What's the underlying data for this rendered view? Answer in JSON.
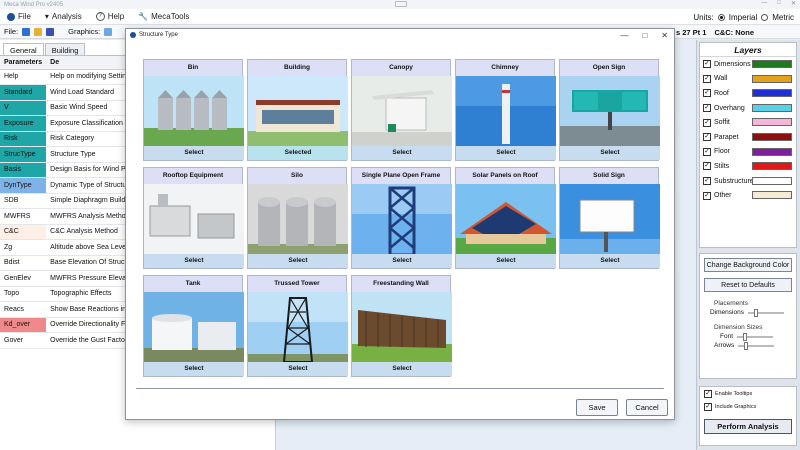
{
  "window": {
    "title": "Meca Wind Pro v2405",
    "controls": [
      "—",
      "□",
      "✕"
    ]
  },
  "menu": {
    "items": [
      {
        "label": "File"
      },
      {
        "label": "Analysis"
      },
      {
        "label": "Help"
      },
      {
        "label": "MecaTools"
      }
    ],
    "units_label": "Units:",
    "unit_imperial": "Imperial",
    "unit_metric": "Metric"
  },
  "toolbar": {
    "file_label": "File:",
    "graphics_label": "Graphics:",
    "zone_info": "s 27 Pt 1",
    "cc_info": "C&C: None"
  },
  "leftpanel": {
    "tabs": [
      "General",
      "Building"
    ],
    "header_code": "Parameters",
    "header_desc": "De",
    "rows": [
      {
        "code": "Help",
        "desc": "Help on modifying Settin",
        "bg": "#ffffff"
      },
      {
        "code": "Standard",
        "desc": "Wind Load Standard",
        "bg": "#1fa6a6"
      },
      {
        "code": "V",
        "desc": "Basic Wind Speed",
        "bg": "#1fa6a6"
      },
      {
        "code": "Exposure",
        "desc": "Exposure Classification",
        "bg": "#1fa6a6"
      },
      {
        "code": "Risk",
        "desc": "Risk Category",
        "bg": "#1fa6a6"
      },
      {
        "code": "StrucType",
        "desc": "Structure Type",
        "bg": "#1fa6a6"
      },
      {
        "code": "Basis",
        "desc": "Design Basis for Wind Pre",
        "bg": "#1fa6a6"
      },
      {
        "code": "DynType",
        "desc": "Dynamic Type of Structur",
        "bg": "#7fb3e8"
      },
      {
        "code": "SDB",
        "desc": "Simple Diaphragm Buildi",
        "bg": "#ffffff"
      },
      {
        "code": "MWFRS",
        "desc": "MWFRS Analysis Method",
        "bg": "#ffffff"
      },
      {
        "code": "C&C",
        "desc": "C&C Analysis Method",
        "bg": "#fdeee6"
      },
      {
        "code": "Zg",
        "desc": "Altitude above Sea Level",
        "bg": "#ffffff"
      },
      {
        "code": "Bdist",
        "desc": "Base Elevation Of Structu",
        "bg": "#ffffff"
      },
      {
        "code": "GenElev",
        "desc": "MWFRS Pressure Elevatio",
        "bg": "#ffffff"
      },
      {
        "code": "Topo",
        "desc": "Topographic Effects",
        "bg": "#ffffff"
      },
      {
        "code": "Reacs",
        "desc": "Show Base Reactions in C",
        "bg": "#ffffff"
      },
      {
        "code": "Kd_over",
        "desc": "Override Directionality Fa",
        "bg": "#f08a8a"
      },
      {
        "code": "Gover",
        "desc": "Override the Gust Factor",
        "bg": "#ffffff"
      }
    ]
  },
  "layers": {
    "title": "Layers",
    "items": [
      {
        "label": "Dimensions",
        "color": "#1e7a1e"
      },
      {
        "label": "Wall",
        "color": "#e2a21c"
      },
      {
        "label": "Roof",
        "color": "#1f2fd6"
      },
      {
        "label": "Overhang",
        "color": "#5ad0e6"
      },
      {
        "label": "Soffit",
        "color": "#f4b7d9"
      },
      {
        "label": "Parapet",
        "color": "#8c1010"
      },
      {
        "label": "Floor",
        "color": "#7e1f9b"
      },
      {
        "label": "Stilts",
        "color": "#e01818"
      },
      {
        "label": "Substructure",
        "color": "#ffffff"
      },
      {
        "label": "Other",
        "color": "#f6ecd6"
      }
    ]
  },
  "options": {
    "change_bg": "Change Background Color",
    "reset": "Reset to Defaults",
    "placements": "Placements",
    "dimensions": "Dimensions",
    "dimension_sizes": "Dimension Sizes",
    "font": "Font",
    "arrows": "Arrows",
    "enable_tooltips": "Enable Tooltips",
    "include_graphics": "Include Graphics",
    "perform": "Perform Analysis"
  },
  "modal": {
    "title": "Structure Type",
    "cards": [
      {
        "title": "Bin",
        "select": "Select",
        "selected": false
      },
      {
        "title": "Building",
        "select": "Selected",
        "selected": true
      },
      {
        "title": "Canopy",
        "select": "Select",
        "selected": false
      },
      {
        "title": "Chimney",
        "select": "Select",
        "selected": false
      },
      {
        "title": "Open Sign",
        "select": "Select",
        "selected": false
      },
      {
        "title": "Rooftop Equipment",
        "select": "Select",
        "selected": false
      },
      {
        "title": "Silo",
        "select": "Select",
        "selected": false
      },
      {
        "title": "Single Plane Open Frame",
        "select": "Select",
        "selected": false
      },
      {
        "title": "Solar Panels on Roof",
        "select": "Select",
        "selected": false
      },
      {
        "title": "Solid Sign",
        "select": "Select",
        "selected": false
      },
      {
        "title": "Tank",
        "select": "Select",
        "selected": false
      },
      {
        "title": "Trussed Tower",
        "select": "Select",
        "selected": false
      },
      {
        "title": "Freestanding Wall",
        "select": "Select",
        "selected": false
      }
    ],
    "save": "Save",
    "cancel": "Cancel"
  }
}
